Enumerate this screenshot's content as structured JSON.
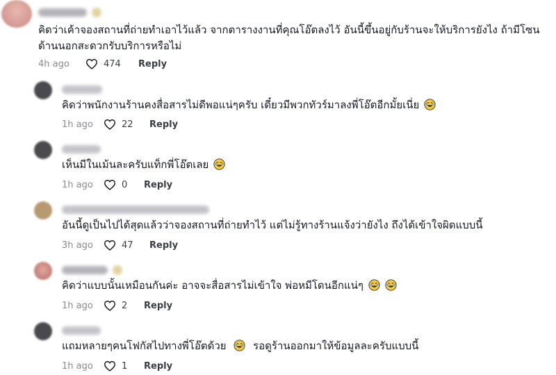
{
  "comments": [
    {
      "text": "คิดว่าเค้าจองสถานที่ถ่ายทำเอาไว้แล้ว จากตารางงานที่คุณโอ๊ตลงไว้ อันนี้ขึ้นอยู่กับร้านจะให้บริการยังไง ถ้ามีโซนด้านนอกสะดวกรับบริการหรือไม่",
      "time": "4h ago",
      "likes": "474",
      "reply": "Reply",
      "emoji": ""
    },
    {
      "text": "คิดว่าพนักงานร้านคงสื่อสารไม่ดีพอแน่ๆครับ เดี๋ยวมีพวกทัวร์มาลงพี่โอ๊ตอีกมั้ยเนี่ย",
      "time": "1h ago",
      "likes": "22",
      "reply": "Reply",
      "emoji": "😂"
    },
    {
      "text": "เห็นมีในเม้นละครับแท็กพี่โอ๊ตเลย",
      "time": "1h ago",
      "likes": "0",
      "reply": "Reply",
      "emoji": "😂"
    },
    {
      "text": "อันนี้ดูเป็นไปได้สุดแล้วว่าจองสถานที่ถ่ายทำไว้ แต่ไม่รู้ทางร้านแจ้งว่ายังไง ถึงได้เข้าใจผิดแบบนี้",
      "time": "3h ago",
      "likes": "47",
      "reply": "Reply",
      "emoji": ""
    },
    {
      "text": "คิดว่าแบบนั้นเหมือนกันค่ะ อาจจะสื่อสารไม่เข้าใจ พ่อหมีโดนอีกแน่ๆ",
      "time": "1h ago",
      "likes": "2",
      "reply": "Reply",
      "emoji": "😂😂"
    },
    {
      "text": "แถมหลายๆคนโฟกัสไปทางพี่โอ๊ตด้วย",
      "text2": "รอดูร้านออกมาให้ข้อมูลละครับแบบนี้",
      "time": "1h ago",
      "likes": "1",
      "reply": "Reply",
      "emoji": "😂"
    }
  ],
  "icons": {
    "heart": "heart-outline-icon",
    "emoji": "laughing-tears-emoji"
  },
  "colors": {
    "text": "#161823",
    "meta": "#8a8b91"
  }
}
